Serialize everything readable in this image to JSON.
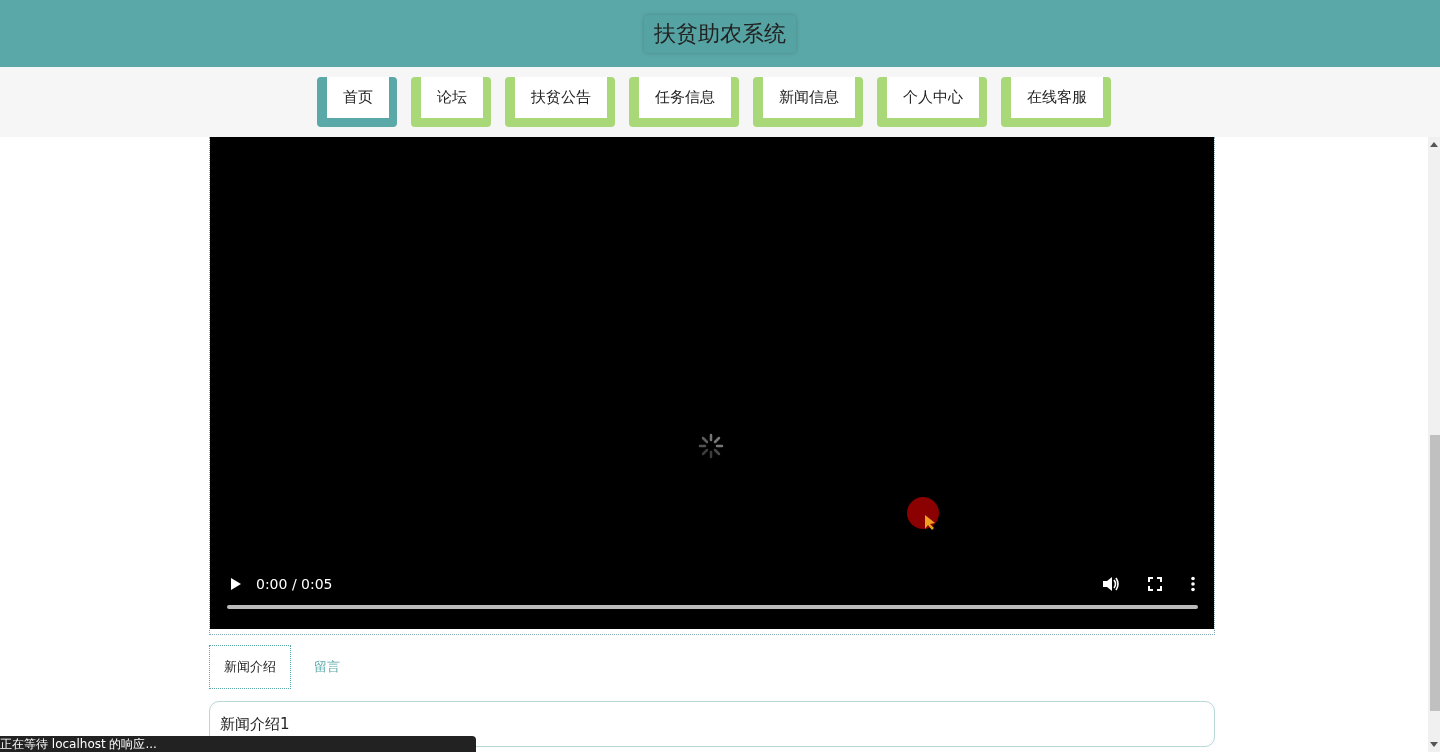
{
  "header": {
    "title": "扶贫助农系统"
  },
  "nav": [
    {
      "label": "首页",
      "selected": true
    },
    {
      "label": "论坛",
      "selected": false
    },
    {
      "label": "扶贫公告",
      "selected": false
    },
    {
      "label": "任务信息",
      "selected": false
    },
    {
      "label": "新闻信息",
      "selected": false
    },
    {
      "label": "个人中心",
      "selected": false
    },
    {
      "label": "在线客服",
      "selected": false
    }
  ],
  "video": {
    "time": "0:00 / 0:05",
    "level": 0
  },
  "tabs": [
    {
      "label": "新闻介绍",
      "selected": true
    },
    {
      "label": "留言",
      "selected": false
    }
  ],
  "content": {
    "text": "新闻介绍1"
  },
  "status_bar": {
    "text": "正在等待 localhost 的响应..."
  }
}
